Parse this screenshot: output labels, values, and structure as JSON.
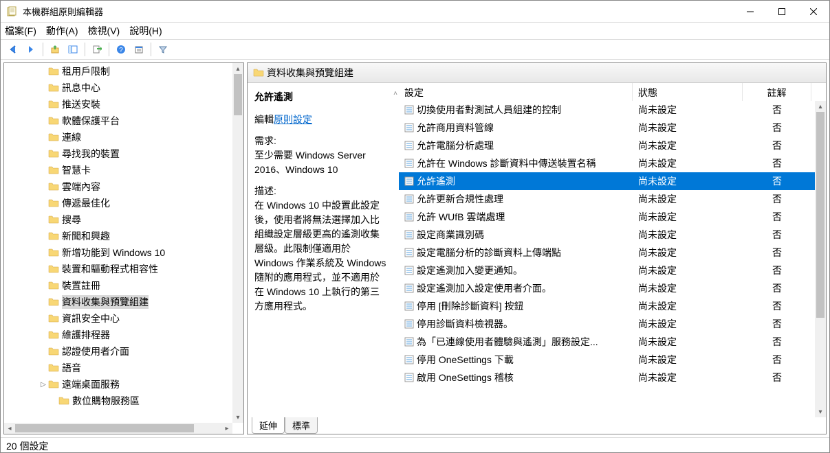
{
  "window": {
    "title": "本機群組原則編輯器"
  },
  "menus": {
    "file": "檔案(F)",
    "action": "動作(A)",
    "view": "檢視(V)",
    "help": "說明(H)"
  },
  "tree": {
    "items": [
      {
        "label": "租用戶限制",
        "level": 1
      },
      {
        "label": "訊息中心",
        "level": 1
      },
      {
        "label": "推送安裝",
        "level": 1
      },
      {
        "label": "軟體保護平台",
        "level": 1
      },
      {
        "label": "連線",
        "level": 1
      },
      {
        "label": "尋找我的裝置",
        "level": 1
      },
      {
        "label": "智慧卡",
        "level": 1
      },
      {
        "label": "雲端內容",
        "level": 1
      },
      {
        "label": "傳遞最佳化",
        "level": 1
      },
      {
        "label": "搜尋",
        "level": 1
      },
      {
        "label": "新聞和興趣",
        "level": 1
      },
      {
        "label": "新增功能到 Windows 10",
        "level": 1
      },
      {
        "label": "裝置和驅動程式相容性",
        "level": 1
      },
      {
        "label": "裝置註冊",
        "level": 1
      },
      {
        "label": "資料收集與預覽組建",
        "level": 1,
        "selected": true
      },
      {
        "label": "資訊安全中心",
        "level": 1
      },
      {
        "label": "維護排程器",
        "level": 1
      },
      {
        "label": "認證使用者介面",
        "level": 1
      },
      {
        "label": "語音",
        "level": 1
      },
      {
        "label": "遠端桌面服務",
        "level": 1,
        "expander": "▷"
      },
      {
        "label": "數位購物服務區",
        "level": 2
      }
    ]
  },
  "content": {
    "header": "資料收集與預覽組建",
    "columns": {
      "setting": "設定",
      "state": "狀態",
      "comment": "註解"
    },
    "desc": {
      "title": "允許遙測",
      "edit_prefix": "編輯",
      "edit_link": "原則設定",
      "req_h": "需求:",
      "req_body": "至少需要 Windows Server 2016、Windows 10",
      "desc_h": "描述:",
      "desc_body": "在 Windows 10 中設置此設定後，使用者將無法選擇加入比組織設定層級更高的遙測收集層級。此限制僅適用於 Windows 作業系統及 Windows 隨附的應用程式，並不適用於在 Windows 10 上執行的第三方應用程式。"
    },
    "rows": [
      {
        "name": "切換使用者對測試人員組建的控制",
        "state": "尚未設定",
        "comment": "否"
      },
      {
        "name": "允許商用資料管線",
        "state": "尚未設定",
        "comment": "否"
      },
      {
        "name": "允許電腦分析處理",
        "state": "尚未設定",
        "comment": "否"
      },
      {
        "name": "允許在 Windows 診斷資料中傳送裝置名稱",
        "state": "尚未設定",
        "comment": "否"
      },
      {
        "name": "允許遙測",
        "state": "尚未設定",
        "comment": "否",
        "selected": true
      },
      {
        "name": "允許更新合規性處理",
        "state": "尚未設定",
        "comment": "否"
      },
      {
        "name": "允許 WUfB 雲端處理",
        "state": "尚未設定",
        "comment": "否"
      },
      {
        "name": "設定商業識別碼",
        "state": "尚未設定",
        "comment": "否"
      },
      {
        "name": "設定電腦分析的診斷資料上傳端點",
        "state": "尚未設定",
        "comment": "否"
      },
      {
        "name": "設定遙測加入變更通知。",
        "state": "尚未設定",
        "comment": "否"
      },
      {
        "name": "設定遙測加入設定使用者介面。",
        "state": "尚未設定",
        "comment": "否"
      },
      {
        "name": "停用 [刪除診斷資料] 按鈕",
        "state": "尚未設定",
        "comment": "否"
      },
      {
        "name": "停用診斷資料檢視器。",
        "state": "尚未設定",
        "comment": "否"
      },
      {
        "name": "為「已連線使用者體驗與遙測」服務設定...",
        "state": "尚未設定",
        "comment": "否"
      },
      {
        "name": "停用 OneSettings 下載",
        "state": "尚未設定",
        "comment": "否"
      },
      {
        "name": "啟用 OneSettings 稽核",
        "state": "尚未設定",
        "comment": "否"
      }
    ],
    "tabs": {
      "extended": "延伸",
      "standard": "標準"
    }
  },
  "status": "20 個設定"
}
